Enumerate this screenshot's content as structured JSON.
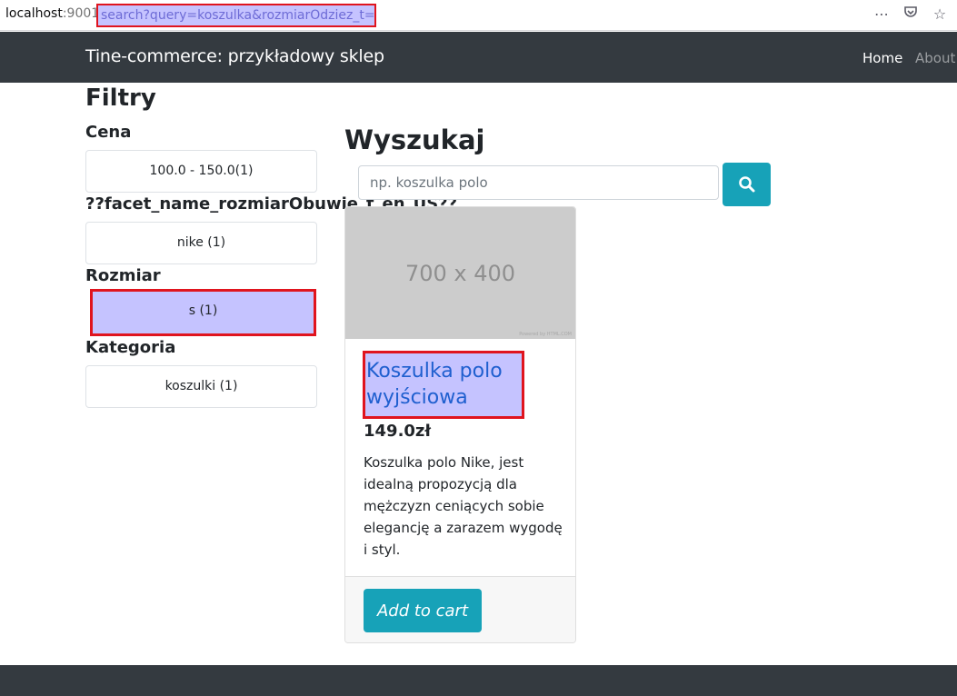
{
  "browser": {
    "url_host": "localhost",
    "url_port": ":9001",
    "url_path": "search?query=koszulka&rozmiarOdziez_t=s",
    "icons": [
      "more-icon",
      "pocket-icon",
      "star-icon"
    ]
  },
  "navbar": {
    "brand": "Tine-commerce: przykładowy sklep",
    "home": "Home",
    "about": "About"
  },
  "filters": {
    "title": "Filtry",
    "facets": [
      {
        "title": "Cena",
        "option": "100.0 - 150.0(1)",
        "active": false
      },
      {
        "title": "??facet_name_rozmiarObuwie_t_en_US??",
        "option": "nike (1)",
        "active": false
      },
      {
        "title": "Rozmiar",
        "option": "s (1)",
        "active": true
      },
      {
        "title": "Kategoria",
        "option": "koszulki (1)",
        "active": false
      }
    ]
  },
  "search": {
    "title": "Wyszukaj",
    "placeholder": "np. koszulka polo",
    "value": "",
    "button_icon": "search-icon"
  },
  "product": {
    "image_text": "700 x 400",
    "image_small_text": "Powered by HTML.COM",
    "title": "Koszulka polo wyjściowa",
    "price": "149.0zł",
    "description": "Koszulka polo Nike, jest idealną propozycją dla mężczyzn ceniących sobie elegancję a zarazem wygodę i styl.",
    "add_to_cart": "Add to cart"
  },
  "colors": {
    "navbar": "#343a40",
    "accent": "#17a2b8",
    "highlight": "#c5c3ff",
    "highlight_border": "#e0141e",
    "link": "#1f5fcf"
  }
}
